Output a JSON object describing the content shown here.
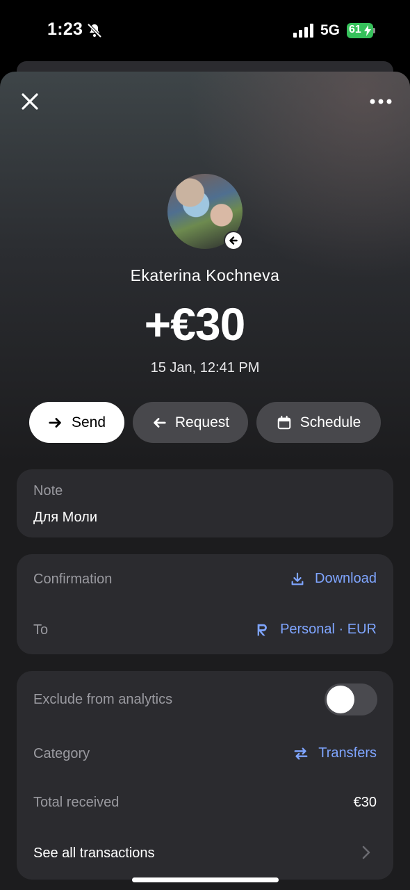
{
  "status_bar": {
    "time": "1:23",
    "network": "5G",
    "battery": "61"
  },
  "contact": {
    "name": "Ekaterina Kochneva"
  },
  "transaction": {
    "amount": "+€30",
    "datetime": "15 Jan, 12:41 PM"
  },
  "actions": {
    "send": "Send",
    "request": "Request",
    "schedule": "Schedule"
  },
  "note": {
    "title": "Note",
    "text": "Для Моли"
  },
  "details": {
    "confirmation_label": "Confirmation",
    "confirmation_value": "Download",
    "to_label": "To",
    "to_value": "Personal · EUR"
  },
  "settings": {
    "exclude_label": "Exclude from analytics",
    "exclude_enabled": false,
    "category_label": "Category",
    "category_value": "Transfers",
    "total_label": "Total received",
    "total_value": "€30",
    "see_all_label": "See all transactions"
  },
  "colors": {
    "accent": "#7fa5ff",
    "card": "#2b2b2f",
    "battery": "#36c15b"
  },
  "icons": [
    "bell-slash-icon",
    "signal-icon",
    "bolt-icon",
    "close-icon",
    "more-icon",
    "arrow-left-icon",
    "arrow-right-icon",
    "calendar-icon",
    "download-icon",
    "revolut-icon",
    "transfer-icon",
    "chevron-right-icon"
  ]
}
